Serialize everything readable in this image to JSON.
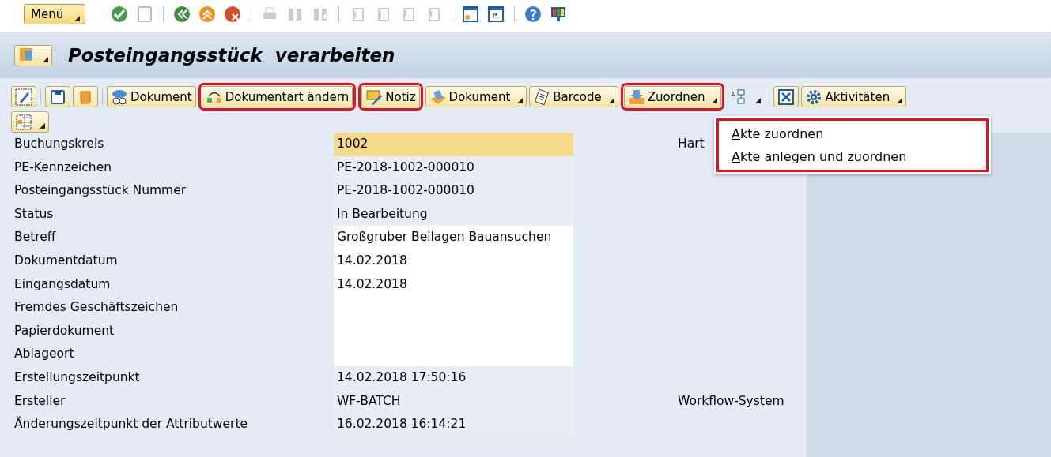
{
  "system_toolbar": {
    "menu": "Menü"
  },
  "title": "Posteingangsstück  verarbeiten",
  "app_toolbar": {
    "buttons": [
      {
        "kind": "icon",
        "highlighted": false
      },
      {
        "kind": "icon",
        "highlighted": false
      },
      {
        "kind": "icon",
        "highlighted": false
      },
      {
        "kind": "text",
        "label": "Dokument",
        "dropdown": false,
        "highlighted": false
      },
      {
        "kind": "text",
        "label": "Dokumentart ändern",
        "dropdown": false,
        "highlighted": true
      },
      {
        "kind": "text",
        "label": "Notiz",
        "dropdown": false,
        "highlighted": true
      },
      {
        "kind": "text",
        "label": "Dokument",
        "dropdown": true,
        "highlighted": false
      },
      {
        "kind": "text",
        "label": "Barcode",
        "dropdown": true,
        "highlighted": false
      },
      {
        "kind": "text",
        "label": "Zuordnen",
        "dropdown": true,
        "highlighted": true
      },
      {
        "kind": "split",
        "highlighted": false
      },
      {
        "kind": "icon",
        "highlighted": false
      },
      {
        "kind": "text",
        "label": "Aktivitäten",
        "dropdown": true,
        "highlighted": false
      }
    ]
  },
  "menu": {
    "highlighted": true,
    "items": [
      {
        "label": "**A**kte zuordnen"
      },
      {
        "label": "**A**kte anlegen und zuordnen"
      }
    ]
  },
  "fields": [
    {
      "label": "Buchungskreis",
      "value": "1002",
      "focused": true,
      "editable": false,
      "extra": "Hart"
    },
    {
      "label": "PE-Kennzeichen",
      "value": "PE-2018-1002-000010",
      "focused": false,
      "editable": false
    },
    {
      "label": "Posteingangsstück Nummer",
      "value": "PE-2018-1002-000010",
      "focused": false,
      "editable": false
    },
    {
      "label": "Status",
      "value": "In Bearbeitung",
      "focused": false,
      "editable": false
    },
    {
      "label": "Betreff",
      "value": "Großgruber Beilagen Bauansuchen",
      "focused": false,
      "editable": true
    },
    {
      "label": "Dokumentdatum",
      "value": "14.02.2018",
      "focused": false,
      "editable": true
    },
    {
      "label": "Eingangsdatum",
      "value": "14.02.2018",
      "focused": false,
      "editable": true
    },
    {
      "label": "Fremdes Geschäftszeichen",
      "focused": false,
      "editable": true
    },
    {
      "label": "Papierdokument",
      "focused": false,
      "editable": true
    },
    {
      "label": "Ablageort",
      "focused": false,
      "editable": true
    },
    {
      "label": "Erstellungszeitpunkt",
      "value": "14.02.2018 17:50:16",
      "focused": false,
      "editable": false
    },
    {
      "label": "Ersteller",
      "value": "WF-BATCH",
      "focused": false,
      "editable": false,
      "extra": "Workflow-System"
    },
    {
      "label": "Änderungszeitpunkt der Attributwerte",
      "value": "16.02.2018 16:14:21",
      "focused": false,
      "editable": false
    }
  ]
}
